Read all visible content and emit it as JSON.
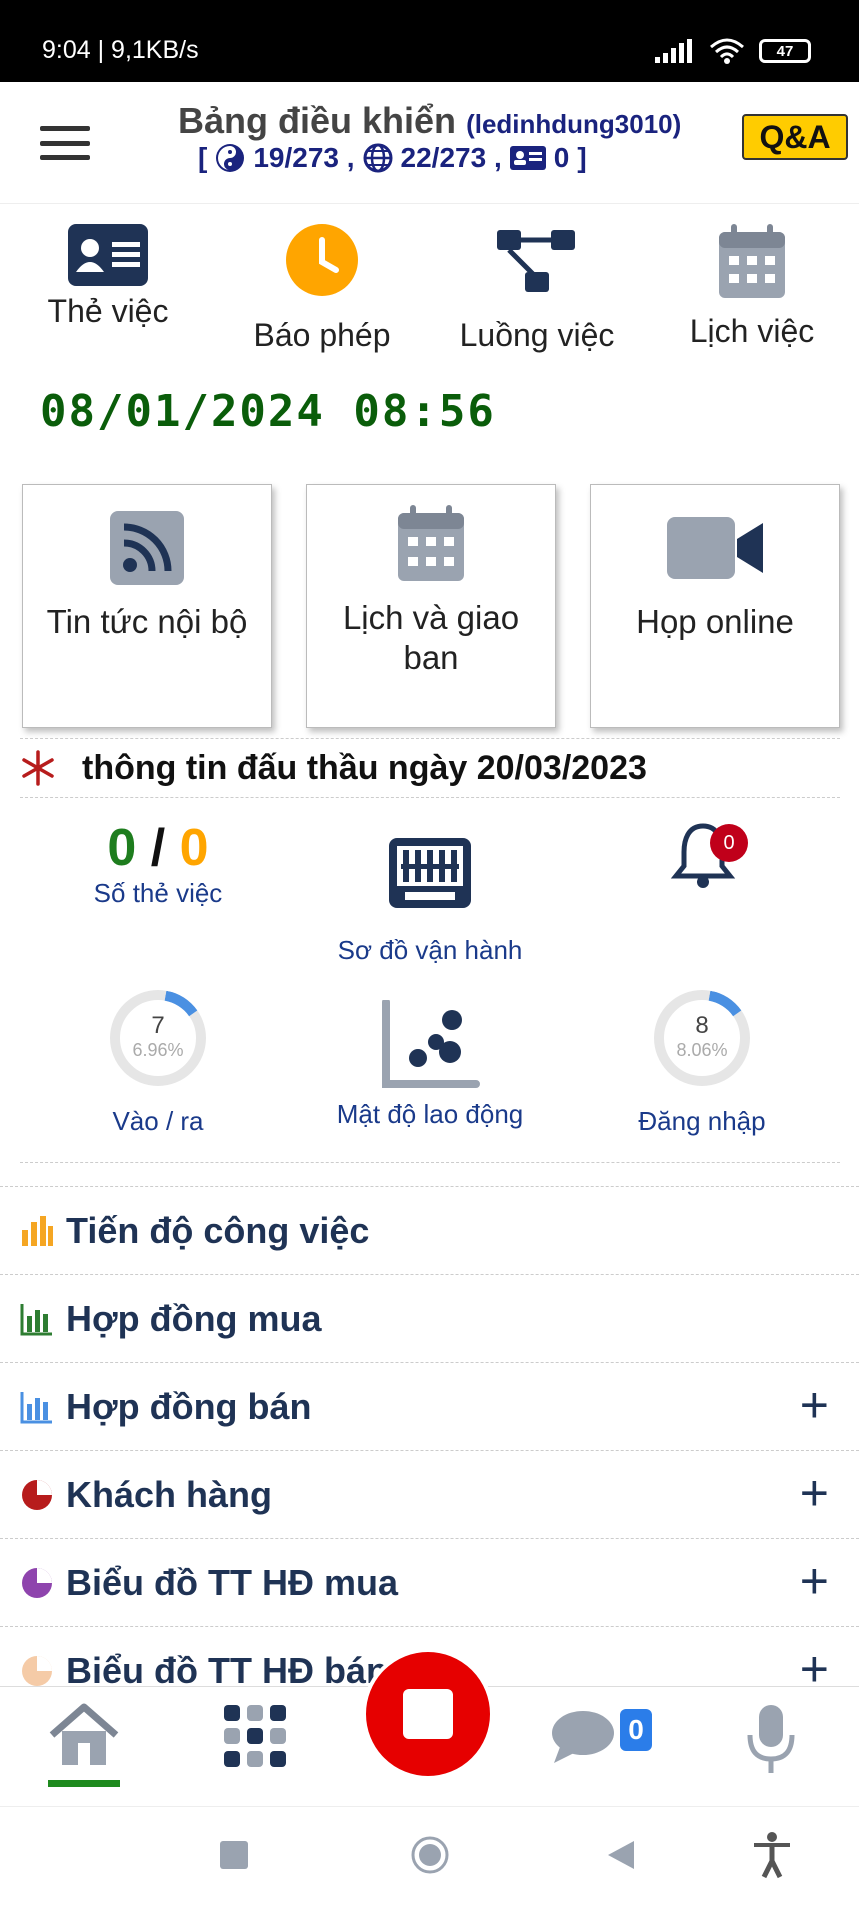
{
  "status": {
    "time": "9:04 | 9,1KB/s",
    "battery": "47"
  },
  "header": {
    "title": "Bảng điều khiển",
    "user": "(ledinhdung3010)",
    "bracket_open": "[",
    "bracket_close": "]",
    "stat_yin": "19/273 ,",
    "stat_globe": "22/273 ,",
    "stat_card": "0",
    "qa": "Q&A"
  },
  "quick": [
    {
      "label": "Thẻ việc",
      "icon": "id-card-icon"
    },
    {
      "label": "Báo phép",
      "icon": "clock-icon"
    },
    {
      "label": "Luồng việc",
      "icon": "workflow-icon"
    },
    {
      "label": "Lịch việc",
      "icon": "calendar-icon"
    }
  ],
  "datetime": "08/01/2024 08:56",
  "cards": [
    {
      "label": "Tin tức nội bộ",
      "icon": "rss-icon"
    },
    {
      "label": "Lịch và giao ban",
      "icon": "calendar-icon"
    },
    {
      "label": "Họp online",
      "icon": "video-camera-icon"
    }
  ],
  "notice": "thông tin đấu thầu ngày 20/03/2023",
  "stats": {
    "cards_done": "0",
    "cards_sep": "/",
    "cards_total": "0",
    "cards_label": "Số thẻ việc",
    "operation_label": "Sơ đồ vận hành",
    "bell_badge": "0",
    "inout_value": "7",
    "inout_pct": "6.96%",
    "inout_label": "Vào / ra",
    "density_label": "Mật độ lao động",
    "login_value": "8",
    "login_pct": "8.06%",
    "login_label": "Đăng nhập"
  },
  "gauges": {
    "inout_fraction": 0.0696,
    "login_fraction": 0.0806
  },
  "list": [
    {
      "label": "Tiến độ công việc",
      "color": "#f5a623",
      "plus": false
    },
    {
      "label": "Hợp đồng mua",
      "color": "#2e7d32",
      "plus": false
    },
    {
      "label": "Hợp đồng bán",
      "color": "#4a90e2",
      "plus": true
    },
    {
      "label": "Khách hàng",
      "color": "#b71c1c",
      "plus": true
    },
    {
      "label": "Biểu đồ TT HĐ mua",
      "color": "#8e44ad",
      "plus": true
    },
    {
      "label": "Biểu đồ TT HĐ bán",
      "color": "#f5cba7",
      "plus": true
    }
  ],
  "bottom": {
    "chat_badge": "0"
  },
  "colors": {
    "accent_green": "#0a5d0a",
    "navy": "#1f3355",
    "fab_red": "#e60000",
    "qa_yellow": "#ffcc00"
  }
}
